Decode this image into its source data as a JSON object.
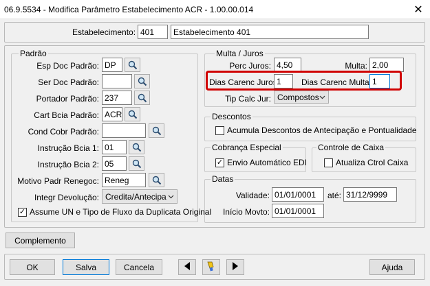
{
  "window": {
    "title": "06.9.5534 - Modifica Parâmetro Estabelecimento ACR - 1.00.00.014",
    "close_glyph": "✕"
  },
  "estabelecimento": {
    "label": "Estabelecimento:",
    "code": "401",
    "name": "Estabelecimento 401"
  },
  "padrao": {
    "title": "Padrão",
    "esp_doc": {
      "label": "Esp Doc Padrão:",
      "value": "DP"
    },
    "ser_doc": {
      "label": "Ser Doc Padrão:",
      "value": ""
    },
    "portador": {
      "label": "Portador Padrão:",
      "value": "237"
    },
    "cart_bcia": {
      "label": "Cart Bcia Padrão:",
      "value": "ACR"
    },
    "cond_cobr": {
      "label": "Cond Cobr Padrão:",
      "value": ""
    },
    "instrucao1": {
      "label": "Instrução Bcia 1:",
      "value": "01"
    },
    "instrucao2": {
      "label": "Instrução Bcia 2:",
      "value": "05"
    },
    "motivo": {
      "label": "Motivo Padr Renegoc:",
      "value": "Reneg"
    },
    "integr": {
      "label": "Integr Devolução:",
      "value": "Credita/Antecipa"
    },
    "assume": {
      "label": "Assume UN e Tipo de Fluxo da Duplicata Original",
      "checked": true
    }
  },
  "multa_juros": {
    "title": "Multa / Juros",
    "perc_juros": {
      "label": "Perc Juros:",
      "value": "4,50"
    },
    "multa": {
      "label": "Multa:",
      "value": "2,00"
    },
    "dias_carenc_juros": {
      "label": "Dias Carenc Juros:",
      "value": "1"
    },
    "dias_carenc_multa": {
      "label": "Dias Carenc Multa:",
      "value": "1"
    },
    "tip_calc": {
      "label": "Tip Calc Jur:",
      "value": "Compostos"
    }
  },
  "descontos": {
    "title": "Descontos",
    "acumula": {
      "label": "Acumula Descontos de Antecipação e Pontualidade",
      "checked": false
    }
  },
  "cobranca": {
    "title": "Cobrança Especial",
    "envio": {
      "label": "Envio Automático EDI",
      "checked": true
    }
  },
  "controle_caixa": {
    "title": "Controle de Caixa",
    "atualiza": {
      "label": "Atualiza Ctrol Caixa",
      "checked": false
    }
  },
  "datas": {
    "title": "Datas",
    "validade": {
      "label": "Validade:",
      "from": "01/01/0001",
      "ate_label": "até:",
      "to": "31/12/9999"
    },
    "inicio": {
      "label": "Início Movto:",
      "value": "01/01/0001"
    }
  },
  "buttons": {
    "complemento": "Complemento",
    "ok": "OK",
    "salva": "Salva",
    "cancela": "Cancela",
    "ajuda": "Ajuda"
  },
  "colors": {
    "highlight": "#d00000",
    "background": "#f0f0f0"
  }
}
